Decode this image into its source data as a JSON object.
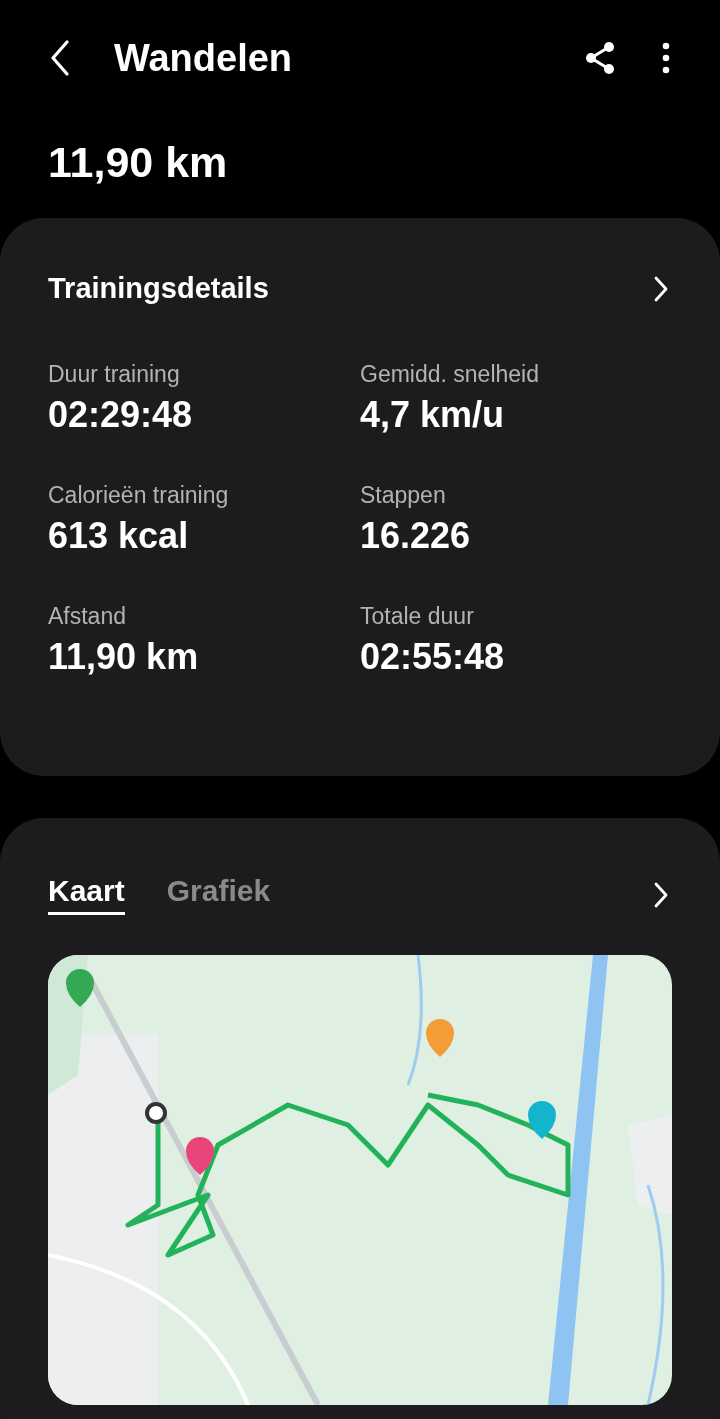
{
  "header": {
    "title": "Wandelen"
  },
  "distance": "11,90 km",
  "details": {
    "title": "Trainingsdetails",
    "stats": [
      {
        "label": "Duur training",
        "value": "02:29:48"
      },
      {
        "label": "Gemidd. snelheid",
        "value": "4,7 km/u"
      },
      {
        "label": "Calorieën training",
        "value": "613 kcal"
      },
      {
        "label": "Stappen",
        "value": "16.226"
      },
      {
        "label": "Afstand",
        "value": "11,90 km"
      },
      {
        "label": "Totale duur",
        "value": "02:55:48"
      }
    ]
  },
  "map_card": {
    "tabs": [
      {
        "label": "Kaart",
        "selected": true
      },
      {
        "label": "Grafiek",
        "selected": false
      }
    ]
  }
}
